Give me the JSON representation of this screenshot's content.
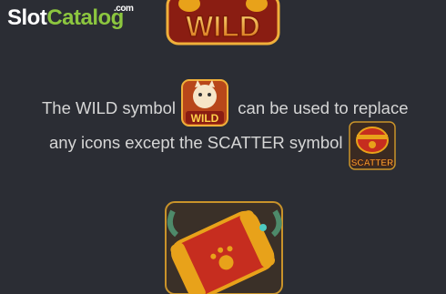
{
  "logo": {
    "slot": "Slot",
    "catalog": "Catalog",
    "com": ".com"
  },
  "top_symbol": {
    "label": "WILD"
  },
  "description": {
    "line1_part1": "The WILD symbol",
    "line1_part2": "can be used to replace",
    "line2": "any icons except the SCATTER symbol"
  },
  "wild_icon": {
    "label": "WILD"
  },
  "scatter_icon": {
    "label": "SCATTER"
  },
  "colors": {
    "background": "#2b2d34",
    "text": "#d6d6d6",
    "accent_green": "#8cc63f",
    "gold": "#e8a21a",
    "red": "#c62d1f"
  }
}
